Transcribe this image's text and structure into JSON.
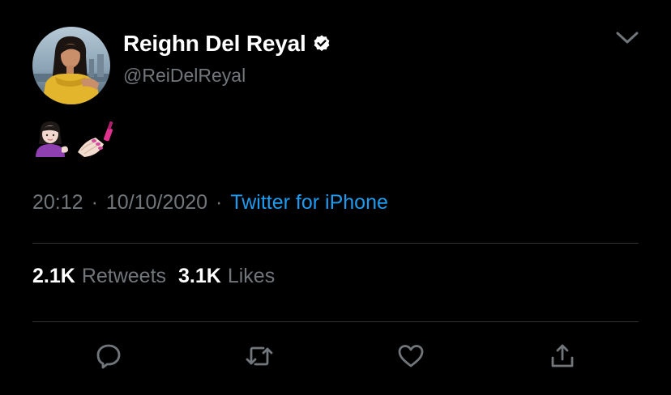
{
  "author": {
    "display_name": "Reighn Del Reyal",
    "handle": "@ReiDelReyal",
    "verified": true,
    "avatar": "profile-photo"
  },
  "tweet": {
    "emojis": [
      "person-tipping-hand-emoji",
      "nail-polish-emoji"
    ]
  },
  "meta": {
    "time": "20:12",
    "separator": "·",
    "date": "10/10/2020",
    "source": "Twitter for iPhone"
  },
  "stats": {
    "retweets_count": "2.1K",
    "retweets_label": "Retweets",
    "likes_count": "3.1K",
    "likes_label": "Likes"
  },
  "actions": [
    "reply-icon",
    "retweet-icon",
    "like-icon",
    "share-icon"
  ],
  "colors": {
    "background": "#000000",
    "text_primary": "#ffffff",
    "text_secondary": "#71767b",
    "link": "#1d9bf0",
    "divider": "#2f3336"
  }
}
